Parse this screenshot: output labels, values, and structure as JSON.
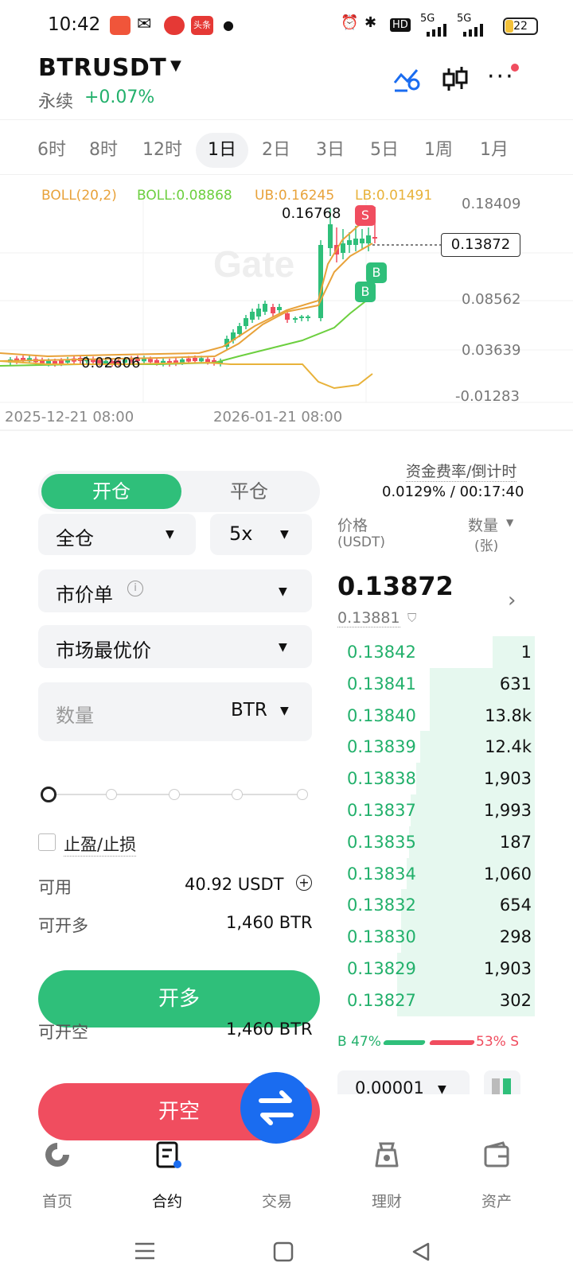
{
  "status_bar": {
    "time": "10:42",
    "hd": "HD",
    "sig1": "5G",
    "sig2": "5G",
    "battery": "22",
    "app_badge_text": "头条"
  },
  "header": {
    "pair": "BTRUSDT",
    "type_label": "永续",
    "change": "+0.07%"
  },
  "tabs": [
    {
      "label": "6时"
    },
    {
      "label": "8时"
    },
    {
      "label": "12时"
    },
    {
      "label": "1日",
      "active": true
    },
    {
      "label": "2日"
    },
    {
      "label": "3日"
    },
    {
      "label": "5日"
    },
    {
      "label": "1周"
    },
    {
      "label": "1月"
    }
  ],
  "chart_data": {
    "type": "candlestick",
    "indicators": {
      "boll": "BOLL(20,2)",
      "boll_mid": "BOLL:0.08868",
      "ub": "UB:0.16245",
      "lb": "LB:0.01491"
    },
    "y_ticks": [
      "0.18409",
      "0.08562",
      "0.03639",
      "-0.01283"
    ],
    "x_ticks": [
      "2025-12-21 08:00",
      "2026-01-21 08:00"
    ],
    "ylim": [
      -0.01283,
      0.18409
    ],
    "high_label": "0.16768",
    "low_label": "0.02606",
    "current_price": "0.13872",
    "watermark": "Gate",
    "markers": {
      "sell": "S",
      "buy": "B"
    },
    "colors": {
      "up": "#2fbf7a",
      "down": "#f04d5f",
      "ub": "#e8a23a",
      "mid": "#e8a23a",
      "lb": "#6ccf3f"
    }
  },
  "trade": {
    "open_tab": "开仓",
    "close_tab": "平仓",
    "margin_mode": "全仓",
    "leverage": "5x",
    "order_type": "市价单",
    "price_mode": "市场最优价",
    "qty_placeholder": "数量",
    "qty_unit": "BTR",
    "tp_sl": "止盈/止损",
    "available_label": "可用",
    "available_value": "40.92 USDT",
    "can_long_label": "可开多",
    "can_long_value": "1,460 BTR",
    "long_btn": "开多",
    "can_short_label": "可开空",
    "can_short_value": "1,460 BTR",
    "short_btn": "开空"
  },
  "funding": {
    "label": "资金费率/倒计时",
    "value": "0.0129% / 00:17:40"
  },
  "orderbook": {
    "price_header": "价格",
    "price_unit": "(USDT)",
    "qty_header": "数量",
    "qty_unit": "(张)",
    "last_price": "0.13872",
    "mark_price": "0.13881",
    "rows": [
      {
        "price": "0.13842",
        "qty": "1",
        "depth": 0.22
      },
      {
        "price": "0.13841",
        "qty": "631",
        "depth": 0.55
      },
      {
        "price": "0.13840",
        "qty": "13.8k",
        "depth": 0.55
      },
      {
        "price": "0.13839",
        "qty": "12.4k",
        "depth": 0.6
      },
      {
        "price": "0.13838",
        "qty": "1,903",
        "depth": 0.62
      },
      {
        "price": "0.13837",
        "qty": "1,993",
        "depth": 0.65
      },
      {
        "price": "0.13835",
        "qty": "187",
        "depth": 0.66
      },
      {
        "price": "0.13834",
        "qty": "1,060",
        "depth": 0.67
      },
      {
        "price": "0.13832",
        "qty": "654",
        "depth": 0.7
      },
      {
        "price": "0.13830",
        "qty": "298",
        "depth": 0.7
      },
      {
        "price": "0.13829",
        "qty": "1,903",
        "depth": 0.72
      },
      {
        "price": "0.13827",
        "qty": "302",
        "depth": 0.72
      }
    ],
    "buy_ratio": "B 47%",
    "sell_ratio": "53% S",
    "precision": "0.00001"
  },
  "nav": [
    {
      "label": "首页"
    },
    {
      "label": "合约"
    },
    {
      "label": "交易"
    },
    {
      "label": "理财"
    },
    {
      "label": "资产"
    }
  ]
}
